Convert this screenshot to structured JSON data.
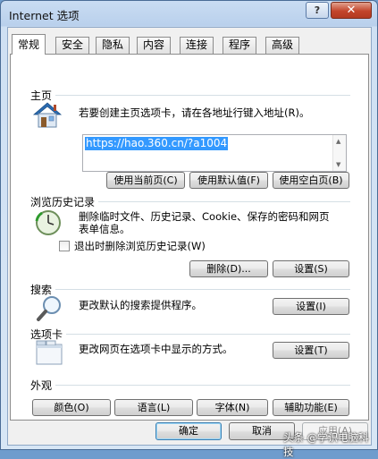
{
  "window": {
    "title": "Internet 选项",
    "help_label": "?",
    "close_label": "✕"
  },
  "tabs": [
    "常规",
    "安全",
    "隐私",
    "内容",
    "连接",
    "程序",
    "高级"
  ],
  "home": {
    "title": "主页",
    "description": "若要创建主页选项卡，请在各地址行键入地址(R)。",
    "url": "https://hao.360.cn/?a1004",
    "buttons": [
      "使用当前页(C)",
      "使用默认值(F)",
      "使用空白页(B)"
    ]
  },
  "history": {
    "title": "浏览历史记录",
    "description_line1": "删除临时文件、历史记录、Cookie、保存的密码和网页",
    "description_line2": "表单信息。",
    "checkbox_label": "退出时删除浏览历史记录(W)",
    "checkbox_checked": false,
    "delete_label": "删除(D)...",
    "settings_label": "设置(S)"
  },
  "search": {
    "title": "搜索",
    "description": "更改默认的搜索提供程序。",
    "settings_label": "设置(I)"
  },
  "tabs_section": {
    "title": "选项卡",
    "description": "更改网页在选项卡中显示的方式。",
    "settings_label": "设置(T)"
  },
  "appearance": {
    "title": "外观",
    "buttons": [
      "颜色(O)",
      "语言(L)",
      "字体(N)",
      "辅助功能(E)"
    ]
  },
  "footer": {
    "ok_label": "确定",
    "cancel_label": "取消",
    "apply_label": "应用(A)"
  },
  "watermark": "头条 @学识电脑科技"
}
